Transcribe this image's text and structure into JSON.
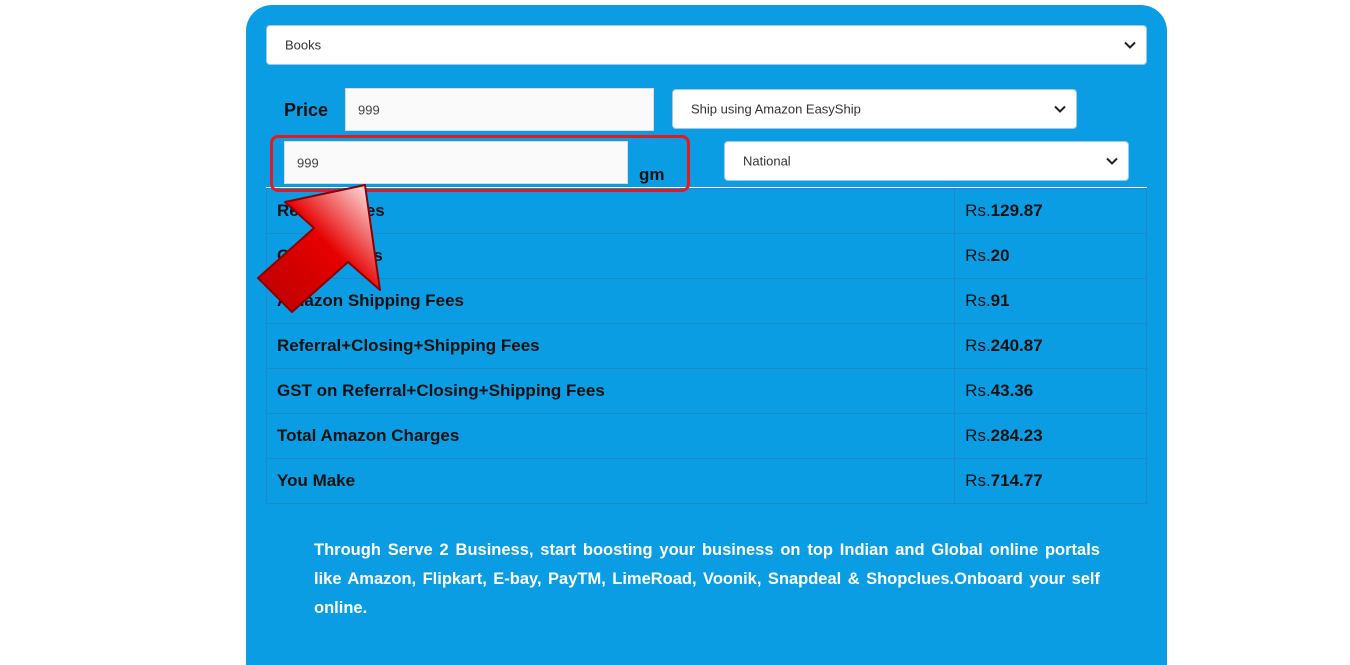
{
  "category_select": {
    "value": "Books"
  },
  "price": {
    "label": "Price",
    "value": "999"
  },
  "shipping_method_select": {
    "value": "Ship using Amazon EasyShip"
  },
  "weight": {
    "value": "999",
    "unit": "gm"
  },
  "region_select": {
    "value": "National"
  },
  "fees_table": {
    "rows": [
      {
        "name": "Referral Fees",
        "currency": "Rs.",
        "amount": "129.87"
      },
      {
        "name": "Closing Fees",
        "currency": "Rs.",
        "amount": "20"
      },
      {
        "name": "Amazon Shipping Fees",
        "currency": "Rs.",
        "amount": "91"
      },
      {
        "name": "Referral+Closing+Shipping Fees",
        "currency": "Rs.",
        "amount": "240.87"
      },
      {
        "name": "GST on Referral+Closing+Shipping Fees",
        "currency": "Rs.",
        "amount": "43.36"
      },
      {
        "name": "Total Amazon Charges",
        "currency": "Rs.",
        "amount": "284.23"
      },
      {
        "name": "You Make",
        "currency": "Rs.",
        "amount": "714.77"
      }
    ]
  },
  "note": {
    "text": "Through Serve 2 Business, start boosting your business on top Indian and Global online portals like Amazon, Flipkart, E-bay, PayTM, LimeRoad, Voonik, Snapdeal & Shopclues.Onboard your self online."
  },
  "icons": {
    "chevron": "chevron-down-icon",
    "pointer": "arrow-pointer-icon"
  },
  "colors": {
    "panel": "#0b9de3",
    "highlight": "#e11b22",
    "arrow": "#d40000"
  }
}
